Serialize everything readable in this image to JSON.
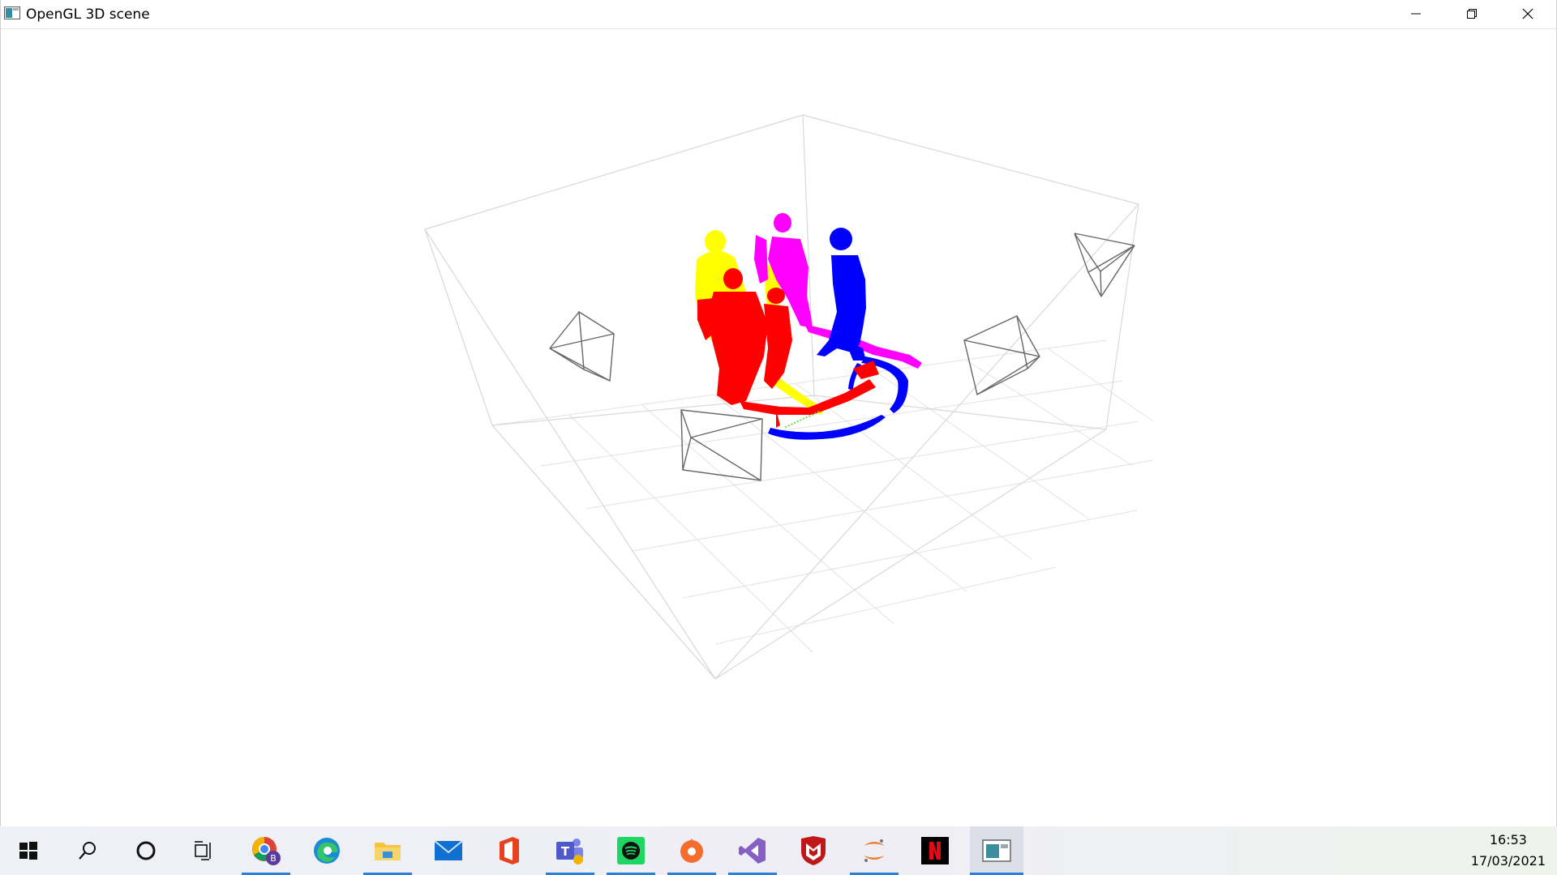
{
  "window": {
    "title": "OpenGL 3D scene",
    "controls": {
      "minimize_icon": "minimize-icon",
      "maximize_icon": "restore-icon",
      "close_icon": "close-icon"
    }
  },
  "scene": {
    "cameras_count": 5,
    "point_cloud_colors": {
      "yellow": "#ffff00",
      "magenta": "#ff00ff",
      "blue": "#0000ff",
      "red": "#ff0000",
      "green": "#66dd44"
    },
    "grid_color": "#dcdcdc",
    "box_color": "#d6d6d6"
  },
  "taskbar": {
    "items": [
      {
        "name": "start",
        "icon": "windows-icon",
        "active": false
      },
      {
        "name": "search",
        "icon": "search-icon",
        "active": false
      },
      {
        "name": "cortana",
        "icon": "cortana-icon",
        "active": false
      },
      {
        "name": "task-view",
        "icon": "task-view-icon",
        "active": false
      },
      {
        "name": "chrome",
        "icon": "chrome-icon",
        "active": true
      },
      {
        "name": "edge",
        "icon": "edge-icon",
        "active": false
      },
      {
        "name": "file-explorer",
        "icon": "folder-icon",
        "active": true
      },
      {
        "name": "mail",
        "icon": "mail-icon",
        "active": false
      },
      {
        "name": "office",
        "icon": "office-icon",
        "active": false
      },
      {
        "name": "teams",
        "icon": "teams-icon",
        "active": true
      },
      {
        "name": "spotify",
        "icon": "spotify-icon",
        "active": true
      },
      {
        "name": "origin",
        "icon": "origin-icon",
        "active": true
      },
      {
        "name": "visual-studio",
        "icon": "visual-studio-icon",
        "active": true
      },
      {
        "name": "mcafee",
        "icon": "mcafee-icon",
        "active": false
      },
      {
        "name": "jupyter",
        "icon": "jupyter-icon",
        "active": true
      },
      {
        "name": "netflix",
        "icon": "netflix-icon",
        "active": false
      },
      {
        "name": "opengl-window",
        "icon": "opengl-window-icon",
        "active": true
      }
    ],
    "clock": {
      "time": "16:53",
      "date": "17/03/2021"
    }
  }
}
